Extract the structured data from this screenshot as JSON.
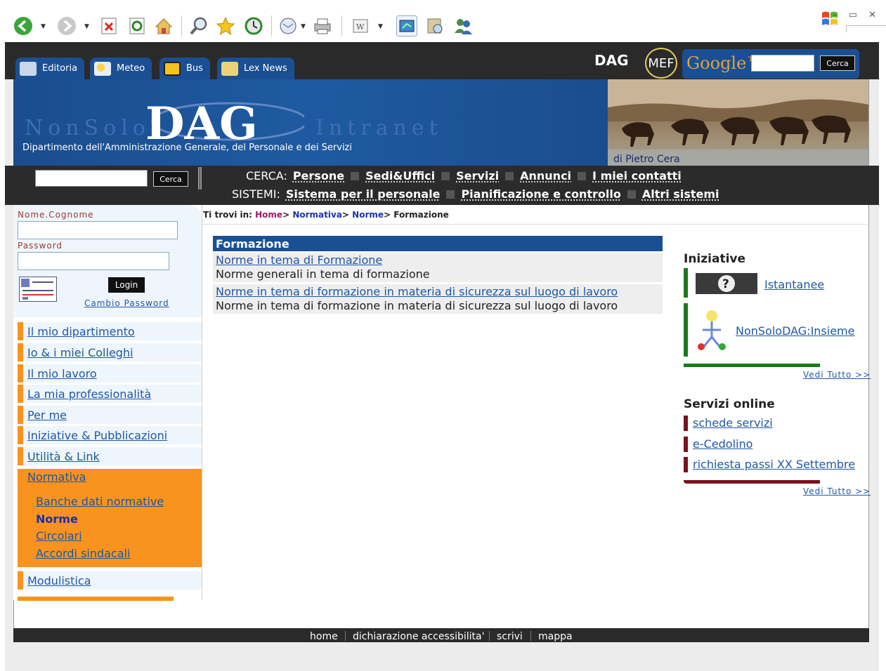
{
  "browser": {
    "icons": [
      "back-icon",
      "forward-icon",
      "stop-icon",
      "refresh-icon",
      "home-icon",
      "search-icon",
      "favorites-icon",
      "history-icon",
      "mail-icon",
      "print-icon",
      "edit-icon",
      "messenger-icon",
      "research-icon",
      "people-icon"
    ],
    "window_controls": "– ▭ ✕"
  },
  "header": {
    "tabs": [
      {
        "label": "Editoria"
      },
      {
        "label": "Meteo"
      },
      {
        "label": "Bus"
      },
      {
        "label": "Lex News"
      }
    ],
    "logo_left": "NonSolo",
    "logo_dag": "DAG",
    "logo_right": "Intranet",
    "subtitle": "Dipartimento dell'Amministrazione Generale, del Personale e dei Servizi",
    "photo_credit": "di Pietro Cera",
    "dag_badge": "DAG",
    "mef_badge": "MEF",
    "google_label": "Google™",
    "google_button": "Cerca"
  },
  "nav": {
    "search_button": "Cerca",
    "cerca_label": "CERCA:",
    "cerca_links": [
      "Persone",
      "Sedi&Uffici",
      "Servizi",
      "Annunci",
      "I miei contatti"
    ],
    "sistemi_label": "SISTEMI:",
    "sistemi_links": [
      "Sistema per il personale",
      "Pianificazione e controllo",
      "Altri sistemi"
    ]
  },
  "login": {
    "user_label": "Nome.Cognome",
    "password_label": "Password",
    "login_button": "Login",
    "change_password": "Cambio Password"
  },
  "menu": {
    "items": [
      "Il mio dipartimento",
      "Io & i miei Colleghi",
      "Il mio lavoro",
      "La mia professionalità",
      "Per me",
      "Iniziative & Pubblicazioni",
      "Utilità & Link"
    ],
    "active": "Normativa",
    "sub_items": [
      "Banche dati normative",
      "Norme",
      "Circolari",
      "Accordi sindacali"
    ],
    "last": "Modulistica"
  },
  "breadcrumb": {
    "prefix": "Ti trovi in:",
    "home": "Home",
    "normativa": "Normativa",
    "norme": "Norme",
    "current": "Formazione",
    "sep": ">"
  },
  "content": {
    "title": "Formazione",
    "rows": [
      {
        "title": "Norme in tema di Formazione",
        "desc": "Norme generali in tema di formazione"
      },
      {
        "title": "Norme in tema di formazione in materia di sicurezza sul luogo di lavoro",
        "desc": "Norme in tema di formazione in materia di sicurezza sul luogo di lavoro"
      }
    ]
  },
  "right": {
    "iniziative_title": "Iniziative",
    "iniziative": [
      "Istantanee",
      "NonSoloDAG:Insieme"
    ],
    "vedi_tutto": "Vedi Tutto >>",
    "servizi_title": "Servizi online",
    "servizi": [
      "schede servizi",
      "e-Cedolino",
      "richiesta passi XX Settembre"
    ]
  },
  "footer": {
    "links": [
      "home",
      "dichiarazione accessibilita'",
      "scrivi",
      "mappa"
    ]
  }
}
